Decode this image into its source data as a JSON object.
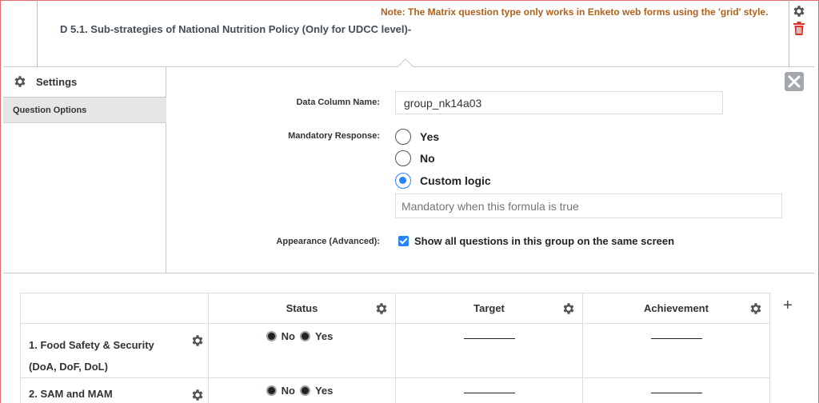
{
  "question": {
    "note": "Note: The Matrix question type only works in Enketo web forms using the 'grid' style.",
    "title": "D 5.1. Sub-strategies of National Nutrition Policy (Only for UDCC level)-"
  },
  "sidebar": {
    "header": "Settings",
    "items": [
      {
        "label": "Question Options"
      }
    ]
  },
  "form": {
    "data_column_label": "Data Column Name:",
    "data_column_value": "group_nk14a03",
    "mandatory_label": "Mandatory Response:",
    "mandatory_options": [
      {
        "label": "Yes",
        "selected": false
      },
      {
        "label": "No",
        "selected": false
      },
      {
        "label": "Custom logic",
        "selected": true
      }
    ],
    "logic_placeholder": "Mandatory when this formula is true",
    "appearance_label": "Appearance (Advanced):",
    "appearance_checkbox_label": "Show all questions in this group on the same screen",
    "appearance_checked": true
  },
  "matrix": {
    "columns": [
      "Status",
      "Target",
      "Achievement"
    ],
    "rows": [
      {
        "label": "1. Food Safety & Security (DoA, DoF, DoL)",
        "options": [
          "No",
          "Yes"
        ]
      },
      {
        "label": "2. SAM and MAM",
        "options": [
          "No",
          "Yes"
        ]
      }
    ],
    "add_symbol": "+"
  },
  "colors": {
    "accent": "#2684ff",
    "note": "#b0611a",
    "delete": "#d9342b",
    "border": "#e06a6a"
  }
}
